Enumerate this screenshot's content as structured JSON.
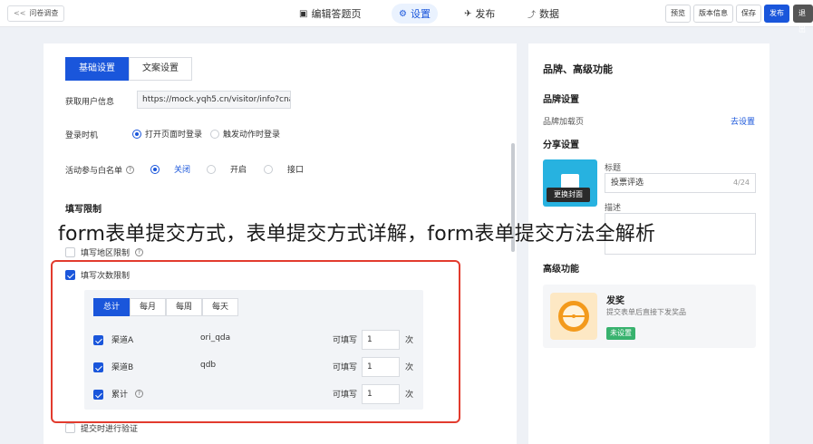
{
  "topbar": {
    "brand": "问卷调查",
    "back_glyph": "<<",
    "nav": [
      {
        "label": "编辑答题页",
        "icon": "▣"
      },
      {
        "label": "设置",
        "icon": "⚙"
      },
      {
        "label": "发布",
        "icon": "✈"
      },
      {
        "label": "数据",
        "icon": "📈"
      }
    ],
    "buttons": {
      "preview": "预览",
      "version": "版本信息",
      "save": "保存",
      "publish": "发布",
      "exit": "退出"
    }
  },
  "left": {
    "tabs": [
      "基础设置",
      "文案设置"
    ],
    "get_user_info_label": "获取用户信息",
    "get_user_info_value": "https://mock.yqh5.cn/visitor/info?cnar",
    "login_label": "登录时机",
    "login_options": [
      "打开页面时登录",
      "触发动作时登录"
    ],
    "whitelist_label": "活动参与白名单",
    "whitelist_options": [
      "关闭",
      "开启",
      "接口"
    ],
    "fill_limit_title": "填写限制",
    "region_limit": "填写地区限制",
    "count_limit": "填写次数限制",
    "period_tabs": [
      "总计",
      "每月",
      "每周",
      "每天"
    ],
    "channels": [
      {
        "name": "渠道A",
        "id": "ori_qda",
        "label": "可填写",
        "value": "1",
        "unit": "次"
      },
      {
        "name": "渠道B",
        "id": "qdb",
        "label": "可填写",
        "value": "1",
        "unit": "次"
      },
      {
        "name": "累计",
        "id": "",
        "label": "可填写",
        "value": "1",
        "unit": "次"
      }
    ],
    "verify_on_submit": "提交时进行验证"
  },
  "right": {
    "title": "品牌、高级功能",
    "brand_section": "品牌设置",
    "brand_loading_page": "品牌加载页",
    "go_setting": "去设置",
    "share_section": "分享设置",
    "cover_button": "更换封面",
    "title_label": "标题",
    "title_value": "投票评选",
    "title_count": "4/24",
    "desc_label": "描述",
    "advanced_section": "高级功能",
    "prize_name": "发奖",
    "prize_desc": "提交表单后直接下发奖品",
    "prize_status": "未设置"
  },
  "caption": "form表单提交方式，表单提交方式详解，form表单提交方法全解析"
}
